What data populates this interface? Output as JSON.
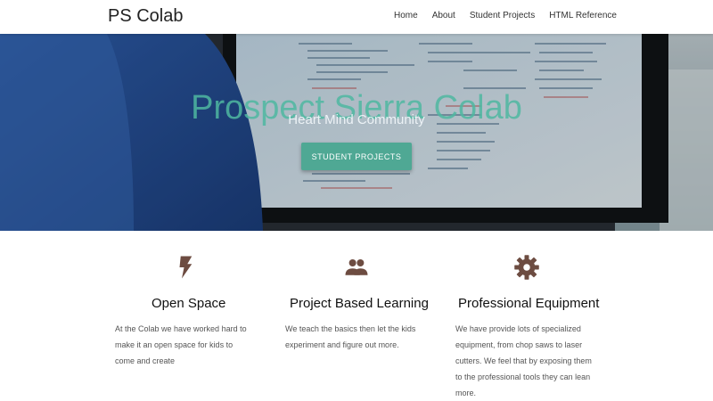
{
  "nav": {
    "brand": "PS Colab",
    "links": [
      "Home",
      "About",
      "Student Projects",
      "HTML Reference"
    ]
  },
  "hero": {
    "title": "Prospect Sierra Colab",
    "subtitle": "Heart Mind Community",
    "button": "STUDENT PROJECTS"
  },
  "features": [
    {
      "icon": "lightning-bolt-icon",
      "title": "Open Space",
      "text": "At the Colab we have worked hard to make it an open space for kids to come and create"
    },
    {
      "icon": "people-icon",
      "title": "Project Based Learning",
      "text": "We teach the basics then let the kids experiment and figure out more."
    },
    {
      "icon": "gear-icon",
      "title": "Professional Equipment",
      "text": "We have provide lots of specialized equipment, from chop saws to laser cutters. We feel that by exposing them to the professional tools they can lean more."
    }
  ],
  "colors": {
    "accent": "#4fa894",
    "icon": "#6d4c41"
  }
}
